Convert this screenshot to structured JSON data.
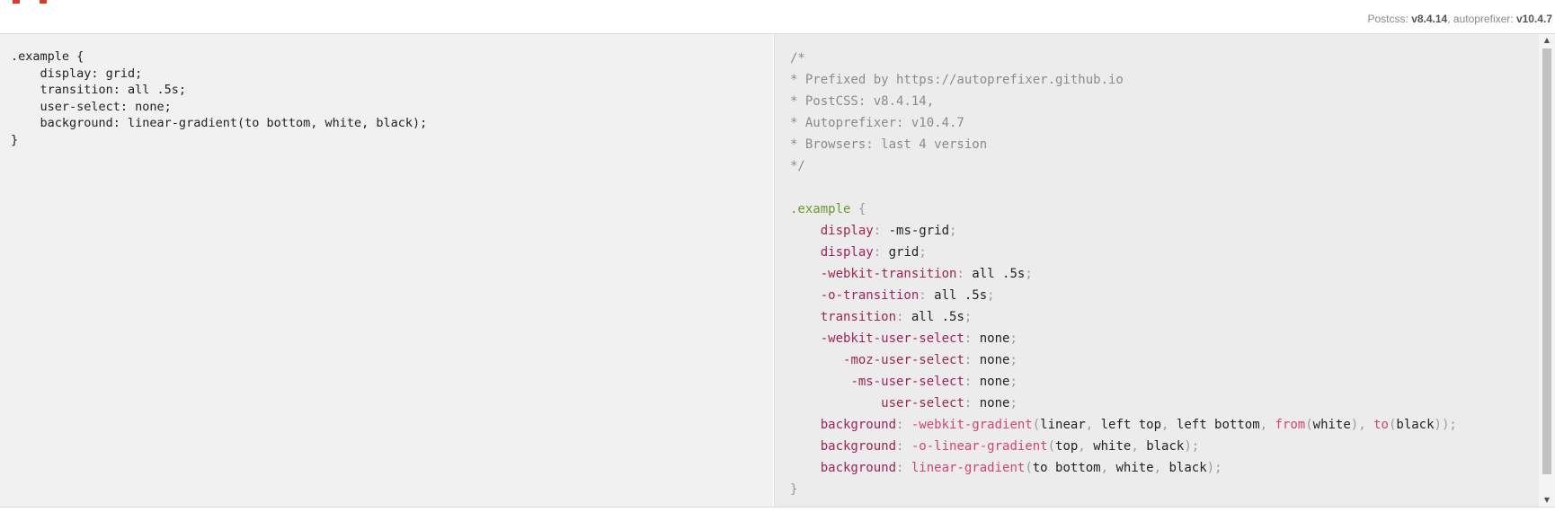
{
  "header": {
    "postcss_label": "Postcss:",
    "postcss_version": "v8.4.14",
    "separator": ", ",
    "autoprefixer_label": "autoprefixer:",
    "autoprefixer_version": "v10.4.7",
    "brand_color": "#d93a2e"
  },
  "input": {
    "lines": [
      ".example {",
      "    display: grid;",
      "    transition: all .5s;",
      "    user-select: none;",
      "    background: linear-gradient(to bottom, white, black);",
      "}"
    ]
  },
  "output": {
    "comment": [
      "/*",
      "* Prefixed by https://autoprefixer.github.io",
      "* PostCSS: v8.4.14,",
      "* Autoprefixer: v10.4.7",
      "* Browsers: last 4 version",
      "*/"
    ],
    "selector": ".example",
    "open_brace": " {",
    "close_brace": "}",
    "declarations": [
      {
        "indent": "    ",
        "prop": "display",
        "parts": [
          {
            "t": "v",
            "s": "-ms-grid"
          }
        ]
      },
      {
        "indent": "    ",
        "prop": "display",
        "parts": [
          {
            "t": "v",
            "s": "grid"
          }
        ]
      },
      {
        "indent": "    ",
        "prop": "-webkit-transition",
        "parts": [
          {
            "t": "v",
            "s": "all .5s"
          }
        ]
      },
      {
        "indent": "    ",
        "prop": "-o-transition",
        "parts": [
          {
            "t": "v",
            "s": "all .5s"
          }
        ]
      },
      {
        "indent": "    ",
        "prop": "transition",
        "parts": [
          {
            "t": "v",
            "s": "all .5s"
          }
        ]
      },
      {
        "indent": "    ",
        "prop": "-webkit-user-select",
        "parts": [
          {
            "t": "v",
            "s": "none"
          }
        ]
      },
      {
        "indent": "       ",
        "prop": "-moz-user-select",
        "parts": [
          {
            "t": "v",
            "s": "none"
          }
        ]
      },
      {
        "indent": "        ",
        "prop": "-ms-user-select",
        "parts": [
          {
            "t": "v",
            "s": "none"
          }
        ]
      },
      {
        "indent": "            ",
        "prop": "user-select",
        "parts": [
          {
            "t": "v",
            "s": "none"
          }
        ]
      },
      {
        "indent": "    ",
        "prop": "background",
        "parts": [
          {
            "t": "f",
            "s": "-webkit-gradient"
          },
          {
            "t": "p",
            "s": "("
          },
          {
            "t": "v",
            "s": "linear"
          },
          {
            "t": "p",
            "s": ", "
          },
          {
            "t": "v",
            "s": "left top"
          },
          {
            "t": "p",
            "s": ", "
          },
          {
            "t": "v",
            "s": "left bottom"
          },
          {
            "t": "p",
            "s": ", "
          },
          {
            "t": "f",
            "s": "from"
          },
          {
            "t": "p",
            "s": "("
          },
          {
            "t": "v",
            "s": "white"
          },
          {
            "t": "p",
            "s": "), "
          },
          {
            "t": "f",
            "s": "to"
          },
          {
            "t": "p",
            "s": "("
          },
          {
            "t": "v",
            "s": "black"
          },
          {
            "t": "p",
            "s": "))"
          }
        ]
      },
      {
        "indent": "    ",
        "prop": "background",
        "parts": [
          {
            "t": "f",
            "s": "-o-linear-gradient"
          },
          {
            "t": "p",
            "s": "("
          },
          {
            "t": "v",
            "s": "top"
          },
          {
            "t": "p",
            "s": ", "
          },
          {
            "t": "v",
            "s": "white"
          },
          {
            "t": "p",
            "s": ", "
          },
          {
            "t": "v",
            "s": "black"
          },
          {
            "t": "p",
            "s": ")"
          }
        ]
      },
      {
        "indent": "    ",
        "prop": "background",
        "parts": [
          {
            "t": "f",
            "s": "linear-gradient"
          },
          {
            "t": "p",
            "s": "("
          },
          {
            "t": "v",
            "s": "to bottom"
          },
          {
            "t": "p",
            "s": ", "
          },
          {
            "t": "v",
            "s": "white"
          },
          {
            "t": "p",
            "s": ", "
          },
          {
            "t": "v",
            "s": "black"
          },
          {
            "t": "p",
            "s": ")"
          }
        ]
      }
    ]
  },
  "scrollbar": {
    "up_glyph": "▲",
    "down_glyph": "▼"
  }
}
